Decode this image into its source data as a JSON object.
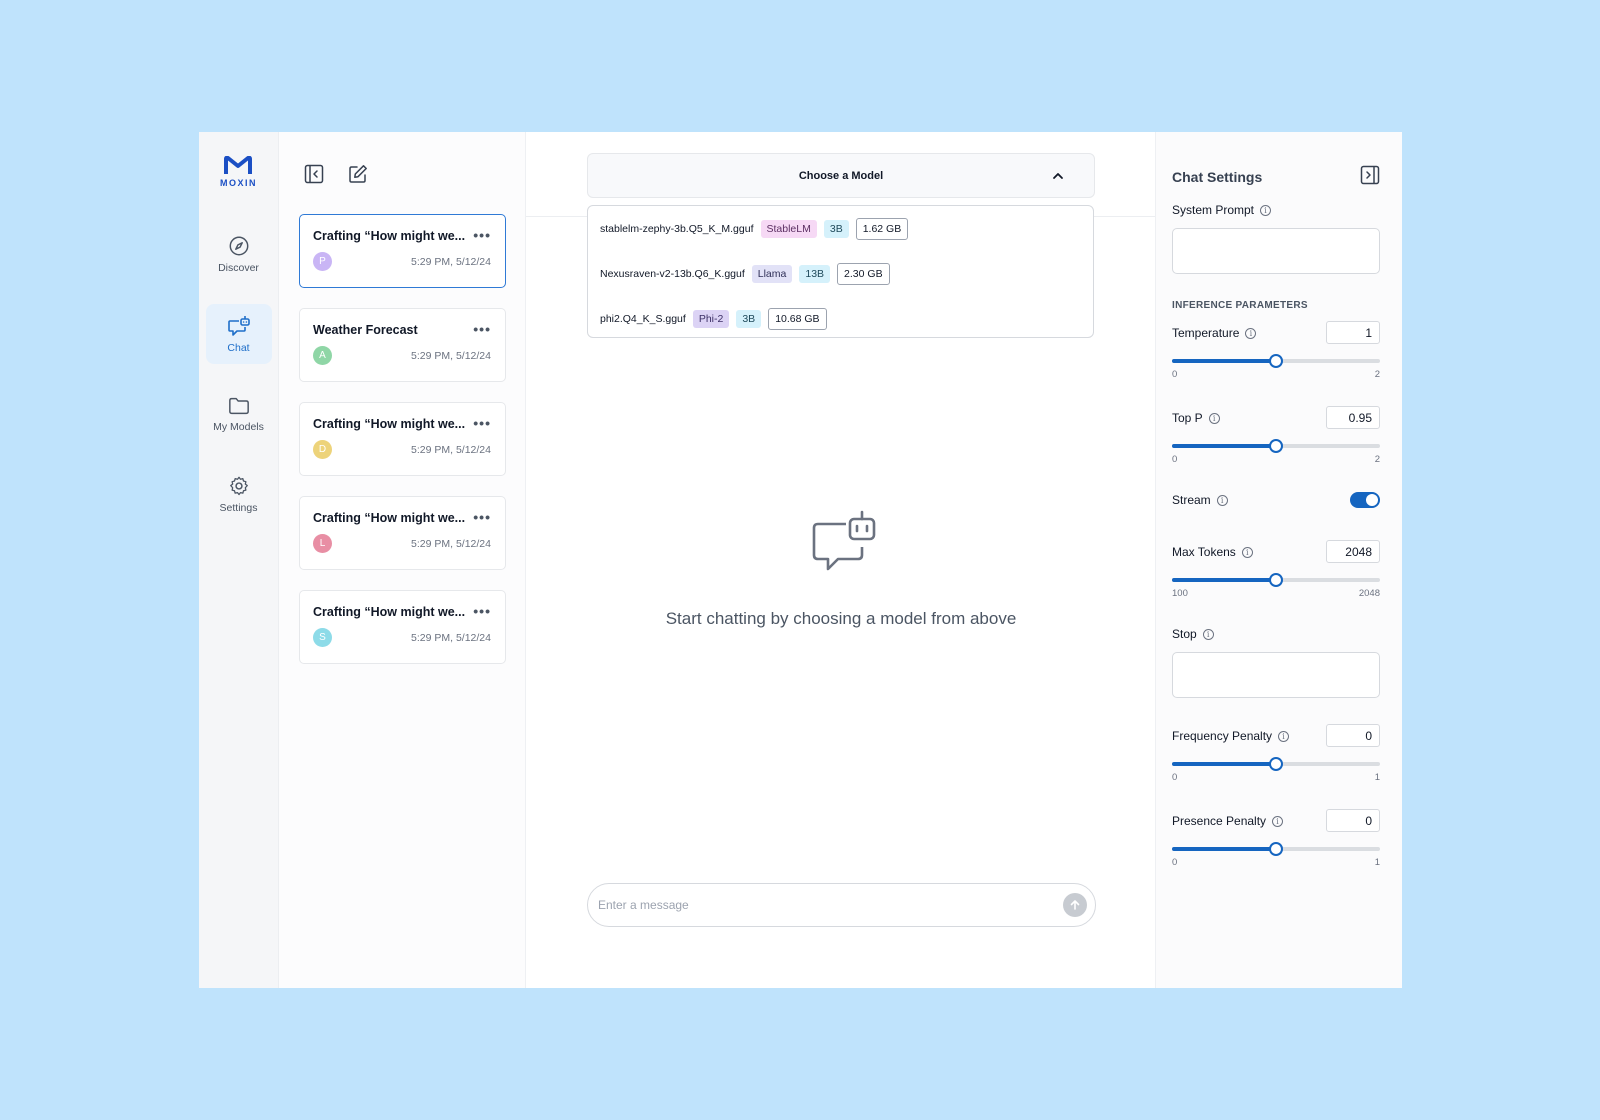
{
  "app": {
    "logo_text": "MOXIN"
  },
  "nav": {
    "items": [
      {
        "label": "Discover",
        "icon": "compass-icon",
        "active": false
      },
      {
        "label": "Chat",
        "icon": "chat-bot-icon",
        "active": true
      },
      {
        "label": "My Models",
        "icon": "folder-icon",
        "active": false
      },
      {
        "label": "Settings",
        "icon": "gear-icon",
        "active": false
      }
    ]
  },
  "chat_list": {
    "chats": [
      {
        "title": "Crafting “How might we...",
        "avatar": "P",
        "avatar_color": "#c9b5f5",
        "time": "5:29 PM, 5/12/24",
        "active": true
      },
      {
        "title": "Weather Forecast",
        "avatar": "A",
        "avatar_color": "#8fd6a6",
        "time": "5:29 PM, 5/12/24",
        "active": false
      },
      {
        "title": "Crafting “How might we...",
        "avatar": "D",
        "avatar_color": "#edd37a",
        "time": "5:29 PM, 5/12/24",
        "active": false
      },
      {
        "title": "Crafting “How might we...",
        "avatar": "L",
        "avatar_color": "#e88ea4",
        "time": "5:29 PM, 5/12/24",
        "active": false
      },
      {
        "title": "Crafting “How might we...",
        "avatar": "S",
        "avatar_color": "#8ddbe8",
        "time": "5:29 PM, 5/12/24",
        "active": false
      }
    ]
  },
  "main": {
    "model_select_label": "Choose a Model",
    "models": [
      {
        "file": "stablelm-zephy-3b.Q5_K_M.gguf",
        "arch": "StableLM",
        "arch_style": "arch-pink",
        "params": "3B",
        "size": "1.62 GB"
      },
      {
        "file": "Nexusraven-v2-13b.Q6_K.gguf",
        "arch": "Llama",
        "arch_style": "arch-lav",
        "params": "13B",
        "size": "2.30 GB"
      },
      {
        "file": "phi2.Q4_K_S.gguf",
        "arch": "Phi-2",
        "arch_style": "arch-purple",
        "params": "3B",
        "size": "10.68 GB"
      }
    ],
    "empty_text": "Start chatting by choosing a model from above",
    "composer_placeholder": "Enter a message"
  },
  "settings": {
    "title": "Chat Settings",
    "system_prompt_label": "System Prompt",
    "system_prompt_value": "",
    "section_title": "INFERENCE PARAMETERS",
    "temperature": {
      "label": "Temperature",
      "value": "1",
      "min": "0",
      "max": "2",
      "fraction": 0.5
    },
    "top_p": {
      "label": "Top P",
      "value": "0.95",
      "min": "0",
      "max": "2",
      "fraction": 0.5
    },
    "stream": {
      "label": "Stream",
      "on": true
    },
    "max_tokens": {
      "label": "Max Tokens",
      "value": "2048",
      "min": "100",
      "max": "2048",
      "fraction": 0.5
    },
    "stop_label": "Stop",
    "stop_value": "",
    "frequency_penalty": {
      "label": "Frequency Penalty",
      "value": "0",
      "min": "0",
      "max": "1",
      "fraction": 0.5
    },
    "presence_penalty": {
      "label": "Presence Penalty",
      "value": "0",
      "min": "0",
      "max": "1",
      "fraction": 0.5
    }
  },
  "colors": {
    "accent": "#1565c0",
    "background": "#bfe3fc",
    "active_nav_bg": "#e6f1fc"
  }
}
